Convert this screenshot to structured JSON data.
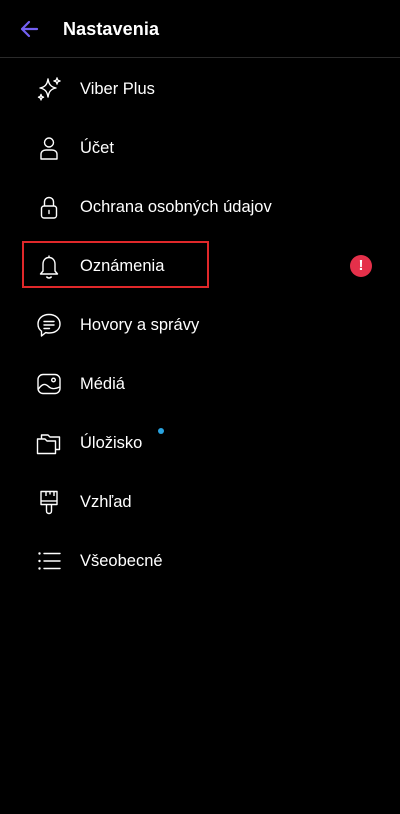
{
  "header": {
    "title": "Nastavenia",
    "back_icon": "arrow-left-icon",
    "accent_color": "#7360f2"
  },
  "menu": {
    "items": [
      {
        "label": "Viber Plus",
        "icon": "sparkles-icon"
      },
      {
        "label": "Účet",
        "icon": "person-icon"
      },
      {
        "label": "Ochrana osobných údajov",
        "icon": "lock-icon",
        "badge": "alert"
      },
      {
        "label": "Oznámenia",
        "icon": "bell-icon",
        "badge_text": "!"
      },
      {
        "label": "Hovory a správy",
        "icon": "chat-bubble-icon",
        "highlighted": true
      },
      {
        "label": "Médiá",
        "icon": "image-icon"
      },
      {
        "label": "Úložisko",
        "icon": "folders-icon",
        "badge": "dot"
      },
      {
        "label": "Vzhľad",
        "icon": "paintbrush-icon"
      },
      {
        "label": "Všeobecné",
        "icon": "list-icon"
      }
    ]
  },
  "colors": {
    "background": "#000000",
    "text": "#ffffff",
    "alert_badge": "#e5304a",
    "dot_badge": "#29a3e0",
    "highlight_border": "#e0282a"
  }
}
